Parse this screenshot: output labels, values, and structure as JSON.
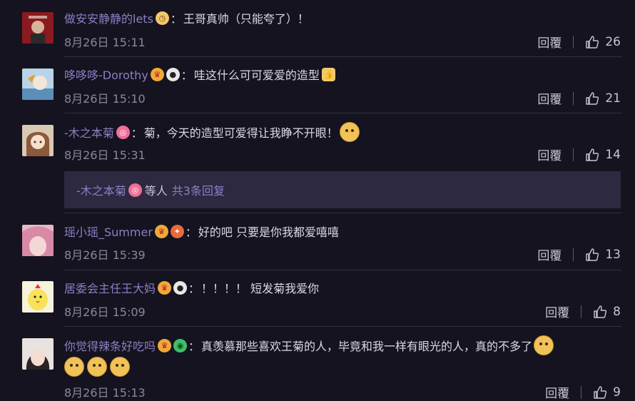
{
  "comments": [
    {
      "user": "做安安静静的lets",
      "separator": "：",
      "text": "王哥真帅（只能夸了）！",
      "date": "8月26日 15:11",
      "reply_label": "回覆",
      "likes": "26"
    },
    {
      "user": "哆哆哆-Dorothy",
      "separator": "：",
      "text": "哇这什么可可爱爱的造型",
      "date": "8月26日 15:10",
      "reply_label": "回覆",
      "likes": "21"
    },
    {
      "user": "-木之本菊",
      "separator": "：",
      "text": "菊，今天的造型可爱得让我睁不开眼！",
      "date": "8月26日 15:31",
      "reply_label": "回覆",
      "likes": "14",
      "replies_user": "-木之本菊",
      "replies_mid": "等人",
      "replies_count": "共3条回复"
    },
    {
      "user": "瑶小瑶_Summer",
      "separator": "：",
      "text": "好的吧 只要是你我都爱嘻嘻",
      "date": "8月26日 15:39",
      "reply_label": "回覆",
      "likes": "13"
    },
    {
      "user": "居委会主任王大妈",
      "separator": "：",
      "text": "！！！！ 短发菊我爱你",
      "date": "8月26日 15:09",
      "reply_label": "回覆",
      "likes": "8"
    },
    {
      "user": "你觉得辣条好吃吗",
      "separator": "：",
      "text": "真羡慕那些喜欢王菊的人，毕竟和我一样有眼光的人，真的不多了",
      "date": "8月26日 15:13",
      "reply_label": "回覆",
      "likes": "9"
    }
  ],
  "colors": {
    "background": "#15131f",
    "username": "#8c7fc4",
    "replies_box": "#2c2940"
  }
}
